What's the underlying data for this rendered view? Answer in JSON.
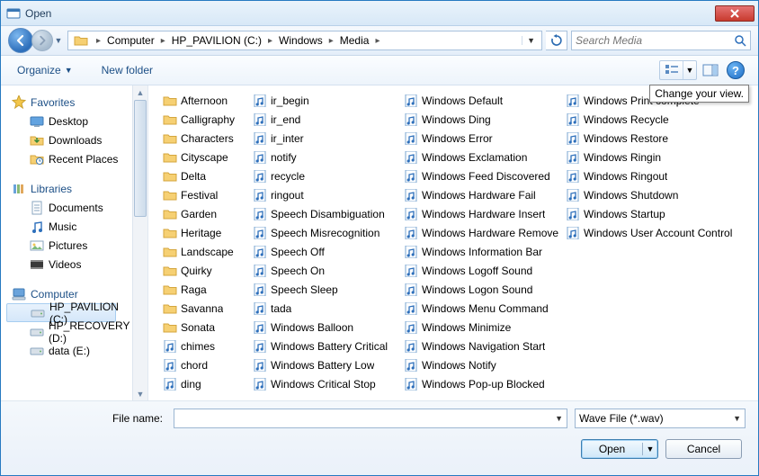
{
  "title": "Open",
  "breadcrumb": [
    "Computer",
    "HP_PAVILION (C:)",
    "Windows",
    "Media"
  ],
  "search": {
    "placeholder": "Search Media"
  },
  "toolbar": {
    "organize": "Organize",
    "newfolder": "New folder"
  },
  "tooltip": "Change your view.",
  "sidebar": {
    "favorites": {
      "label": "Favorites",
      "items": [
        "Desktop",
        "Downloads",
        "Recent Places"
      ]
    },
    "libraries": {
      "label": "Libraries",
      "items": [
        "Documents",
        "Music",
        "Pictures",
        "Videos"
      ]
    },
    "computer": {
      "label": "Computer",
      "items": [
        "HP_PAVILION (C:)",
        "HP_RECOVERY (D:)",
        "data (E:)"
      ]
    }
  },
  "files": {
    "col1": [
      {
        "n": "Afternoon",
        "t": "folder"
      },
      {
        "n": "Calligraphy",
        "t": "folder"
      },
      {
        "n": "Characters",
        "t": "folder"
      },
      {
        "n": "Cityscape",
        "t": "folder"
      },
      {
        "n": "Delta",
        "t": "folder"
      },
      {
        "n": "Festival",
        "t": "folder"
      },
      {
        "n": "Garden",
        "t": "folder"
      },
      {
        "n": "Heritage",
        "t": "folder"
      },
      {
        "n": "Landscape",
        "t": "folder"
      },
      {
        "n": "Quirky",
        "t": "folder"
      },
      {
        "n": "Raga",
        "t": "folder"
      },
      {
        "n": "Savanna",
        "t": "folder"
      },
      {
        "n": "Sonata",
        "t": "folder"
      },
      {
        "n": "chimes",
        "t": "wav"
      },
      {
        "n": "chord",
        "t": "wav"
      },
      {
        "n": "ding",
        "t": "wav"
      }
    ],
    "col2": [
      {
        "n": "ir_begin",
        "t": "wav"
      },
      {
        "n": "ir_end",
        "t": "wav"
      },
      {
        "n": "ir_inter",
        "t": "wav"
      },
      {
        "n": "notify",
        "t": "wav"
      },
      {
        "n": "recycle",
        "t": "wav"
      },
      {
        "n": "ringout",
        "t": "wav"
      },
      {
        "n": "Speech Disambiguation",
        "t": "wav"
      },
      {
        "n": "Speech Misrecognition",
        "t": "wav"
      },
      {
        "n": "Speech Off",
        "t": "wav"
      },
      {
        "n": "Speech On",
        "t": "wav"
      },
      {
        "n": "Speech Sleep",
        "t": "wav"
      },
      {
        "n": "tada",
        "t": "wav"
      },
      {
        "n": "Windows Balloon",
        "t": "wav"
      },
      {
        "n": "Windows Battery Critical",
        "t": "wav"
      },
      {
        "n": "Windows Battery Low",
        "t": "wav"
      },
      {
        "n": "Windows Critical Stop",
        "t": "wav"
      }
    ],
    "col3": [
      {
        "n": "Windows Default",
        "t": "wav"
      },
      {
        "n": "Windows Ding",
        "t": "wav"
      },
      {
        "n": "Windows Error",
        "t": "wav"
      },
      {
        "n": "Windows Exclamation",
        "t": "wav"
      },
      {
        "n": "Windows Feed Discovered",
        "t": "wav"
      },
      {
        "n": "Windows Hardware Fail",
        "t": "wav"
      },
      {
        "n": "Windows Hardware Insert",
        "t": "wav"
      },
      {
        "n": "Windows Hardware Remove",
        "t": "wav"
      },
      {
        "n": "Windows Information Bar",
        "t": "wav"
      },
      {
        "n": "Windows Logoff Sound",
        "t": "wav"
      },
      {
        "n": "Windows Logon Sound",
        "t": "wav"
      },
      {
        "n": "Windows Menu Command",
        "t": "wav"
      },
      {
        "n": "Windows Minimize",
        "t": "wav"
      },
      {
        "n": "Windows Navigation Start",
        "t": "wav"
      },
      {
        "n": "Windows Notify",
        "t": "wav"
      },
      {
        "n": "Windows Pop-up Blocked",
        "t": "wav"
      }
    ],
    "col4": [
      {
        "n": "Windows Print complete",
        "t": "wav"
      },
      {
        "n": "Windows Recycle",
        "t": "wav"
      },
      {
        "n": "Windows Restore",
        "t": "wav"
      },
      {
        "n": "Windows Ringin",
        "t": "wav"
      },
      {
        "n": "Windows Ringout",
        "t": "wav"
      },
      {
        "n": "Windows Shutdown",
        "t": "wav"
      },
      {
        "n": "Windows Startup",
        "t": "wav"
      },
      {
        "n": "Windows User Account Control",
        "t": "wav"
      }
    ]
  },
  "bottom": {
    "filename_label": "File name:",
    "filetype": "Wave File (*.wav)",
    "open": "Open",
    "cancel": "Cancel"
  }
}
